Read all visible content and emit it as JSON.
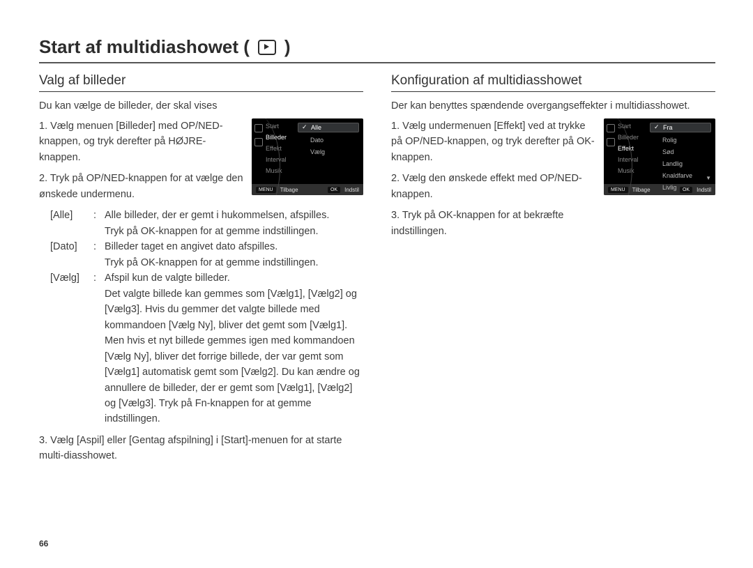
{
  "page_number": "66",
  "title": "Start af multidiashowet (",
  "title_close": ")",
  "left": {
    "heading": "Valg af billeder",
    "intro": "Du kan vælge de billeder, der skal vises",
    "step1": "1. Vælg menuen [Billeder] med OP/NED-knappen, og tryk derefter på HØJRE-knappen.",
    "step2": "2. Tryk på OP/NED-knappen for at vælge den ønskede undermenu.",
    "defs": {
      "alle_term": "[Alle]",
      "alle_desc": "Alle billeder, der er gemt i hukommelsen, afspilles.",
      "alle_note": "Tryk på OK-knappen for at gemme indstillingen.",
      "dato_term": "[Dato]",
      "dato_desc": "Billeder taget en angivet dato afspilles.",
      "dato_note": "Tryk på OK-knappen for at gemme indstillingen.",
      "vaelg_term": "[Vælg]",
      "vaelg_desc": "Afspil kun de valgte billeder.",
      "vaelg_long": "Det valgte billede kan gemmes som [Vælg1], [Vælg2] og [Vælg3]. Hvis du gemmer det valgte billede med kommandoen [Vælg Ny], bliver det gemt som [Vælg1]. Men hvis et nyt billede gemmes igen med kommandoen [Vælg Ny], bliver det forrige billede, der var gemt som [Vælg1] automatisk gemt som [Vælg2]. Du kan ændre og annullere de billeder, der er gemt som [Vælg1], [Vælg2] og [Vælg3]. Tryk på Fn-knappen for at gemme indstillingen."
    },
    "step3": "3. Vælg [Aspil] eller [Gentag afspilning] i [Start]-menuen for at starte multi-diasshowet.",
    "screen": {
      "menu": {
        "start": "Start",
        "billeder": "Billeder",
        "effekt": "Effekt",
        "interval": "Interval",
        "musik": "Musik"
      },
      "opts": {
        "alle": "Alle",
        "dato": "Dato",
        "vaelg": "Vælg"
      },
      "bar": {
        "back_btn": "MENU",
        "back": "Tilbage",
        "ok_btn": "OK",
        "set": "Indstil"
      }
    }
  },
  "right": {
    "heading": "Konfiguration af multidiasshowet",
    "intro": "Der kan benyttes spændende overgangseffekter i multidiasshowet.",
    "step1": "1. Vælg undermenuen [Effekt] ved at trykke på OP/NED-knappen, og tryk derefter på OK-knappen.",
    "step2": "2. Vælg den ønskede effekt med OP/NED-knappen.",
    "step3": "3. Tryk på OK-knappen for at bekræfte indstillingen.",
    "screen": {
      "menu": {
        "start": "Start",
        "billeder": "Billeder",
        "effekt": "Effekt",
        "interval": "Interval",
        "musik": "Musik"
      },
      "opts": {
        "fra": "Fra",
        "rolig": "Rolig",
        "sod": "Sød",
        "landlig": "Landlig",
        "knaldfarve": "Knaldfarve",
        "livlig": "Livlig"
      },
      "bar": {
        "back_btn": "MENU",
        "back": "Tilbage",
        "ok_btn": "OK",
        "set": "Indstil"
      }
    }
  }
}
